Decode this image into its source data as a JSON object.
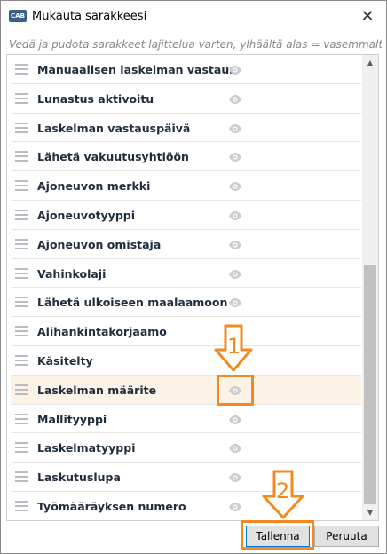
{
  "window": {
    "app_icon_text": "CAB",
    "title": "Mukauta sarakkeesi",
    "close_glyph": "✕"
  },
  "instruction": "Vedä ja pudota sarakkeet lajittelua varten, ylhäältä alas = vasemmalta oikealle.",
  "columns": [
    {
      "label": "Manuaalisen laskelman vastaus",
      "visible": false
    },
    {
      "label": "Lunastus aktivoitu",
      "visible": false
    },
    {
      "label": "Laskelman vastauspäivä",
      "visible": false
    },
    {
      "label": "Lähetä vakuutusyhtiöön",
      "visible": false
    },
    {
      "label": "Ajoneuvon merkki",
      "visible": false
    },
    {
      "label": "Ajoneuvotyyppi",
      "visible": false
    },
    {
      "label": "Ajoneuvon omistaja",
      "visible": false
    },
    {
      "label": "Vahinkolaji",
      "visible": false
    },
    {
      "label": "Lähetä ulkoiseen maalaamoon",
      "visible": false
    },
    {
      "label": "Alihankintakorjaamo",
      "visible": false
    },
    {
      "label": "Käsitelty",
      "visible": false
    },
    {
      "label": "Laskelman määrite",
      "visible": false,
      "highlighted": true
    },
    {
      "label": "Mallityyppi",
      "visible": false
    },
    {
      "label": "Laskelmatyyppi",
      "visible": false
    },
    {
      "label": "Laskutuslupa",
      "visible": false
    },
    {
      "label": "Työmääräyksen numero",
      "visible": false
    }
  ],
  "scrollbar": {
    "up_glyph": "▲",
    "down_glyph": "▼"
  },
  "buttons": {
    "save": "Tallenna",
    "cancel": "Peruuta"
  },
  "annotations": {
    "step1": "1",
    "step2": "2",
    "color": "#f5891f"
  },
  "colors": {
    "eye_icon": "#c9ccd1",
    "highlight_row": "#fdf2e6",
    "label_text": "#1f2d3d"
  }
}
